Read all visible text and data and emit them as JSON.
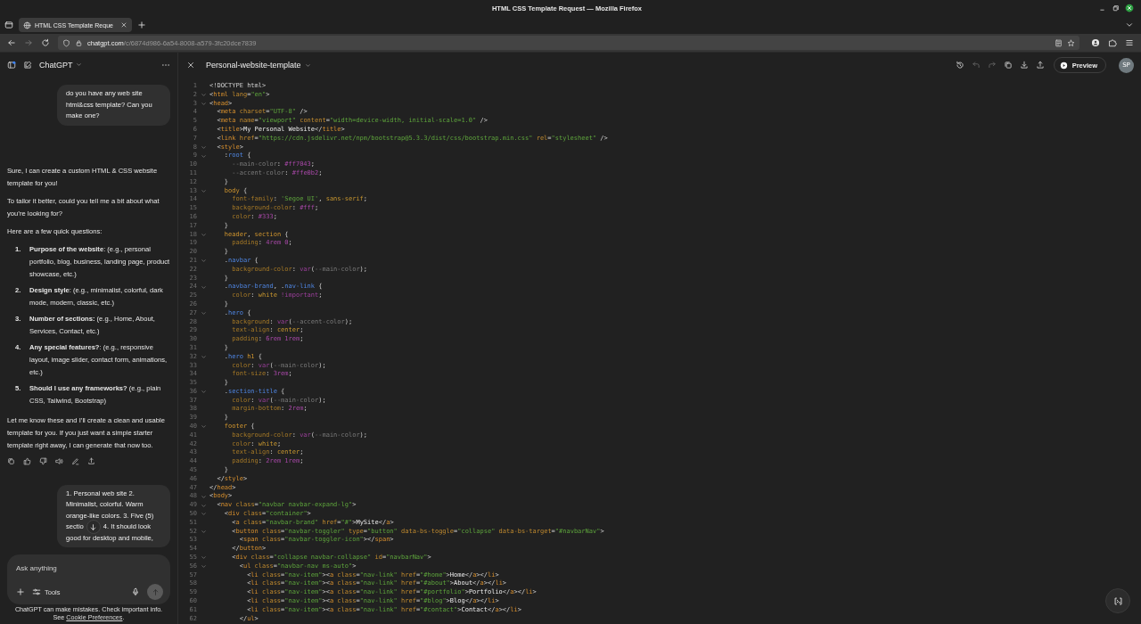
{
  "window": {
    "title": "HTML CSS Template Request — Mozilla Firefox"
  },
  "browser": {
    "tabs": [
      {
        "title": "HTML CSS Template Reque",
        "selected": true
      }
    ],
    "nav": [
      {
        "kind": "back",
        "disabled": false
      },
      {
        "kind": "forward",
        "disabled": true
      },
      {
        "kind": "reload",
        "disabled": false
      }
    ],
    "url": {
      "host": "chatgpt.com",
      "path": "/c/6874d986-6a54-8008-a579-3fc20dce7839"
    }
  },
  "chat": {
    "title": "ChatGPT",
    "messages": [
      {
        "kind": "user",
        "text": "do you have any web site html&css template? Can you make one?"
      },
      {
        "kind": "assistant",
        "blocks": [
          {
            "kind": "paragraph",
            "text": "Sure, I can create a custom HTML & CSS website template for you!"
          },
          {
            "kind": "paragraph",
            "text": "To tailor it better, could you tell me a bit about what you’re looking for?"
          },
          {
            "kind": "paragraph",
            "text": "Here are a few quick questions:"
          },
          {
            "kind": "list",
            "items": [
              {
                "number": "1.",
                "text": "**Purpose of the website**: (e.g., personal portfolio, blog, business, landing page, product showcase, etc.)"
              },
              {
                "number": "2.",
                "text": "**Design style**: (e.g., minimalist, colorful, dark mode, modern, classic, etc.)"
              },
              {
                "number": "3.",
                "text": "**Number of sections:** (e.g., Home, About, Services, Contact, etc.)"
              },
              {
                "number": "4.",
                "text": "**Any special features?**: (e.g., responsive layout, image slider, contact form, animations, etc.)"
              },
              {
                "number": "5.",
                "text": "**Should I use any frameworks?** (e.g., plain CSS, Tailwind, Bootstrap)"
              }
            ]
          },
          {
            "kind": "paragraph",
            "text": "Let me know these and I’ll create a clean and usable template for you. If you just want a simple starter template right away, I can generate that now too."
          }
        ],
        "actions": [
          {
            "kind": "copy"
          },
          {
            "kind": "thumbs-up"
          },
          {
            "kind": "thumbs-down"
          },
          {
            "kind": "read-aloud"
          },
          {
            "kind": "edit"
          },
          {
            "kind": "share"
          }
        ]
      },
      {
        "kind": "user",
        "lines": [
          [
            "1. Personal web site 2."
          ],
          [
            "Minimalist, colorful. Warm"
          ],
          [
            "orange-like colors. 3. Five (5)"
          ],
          [
            "sectio",
            "4. It should look"
          ],
          [
            "good for desktop and mobile,"
          ]
        ]
      }
    ],
    "composer": {
      "placeholder": "Ask anything",
      "tools": "Tools"
    },
    "footer": {
      "note": "ChatGPT can make mistakes. Check important info.",
      "before": "See",
      "link": "Cookie Preferences",
      "after": "."
    }
  },
  "canvas": {
    "title": "Personal-website-template",
    "tools": [
      {
        "kind": "history",
        "disabled": false
      },
      {
        "kind": "undo",
        "disabled": true
      },
      {
        "kind": "redo",
        "disabled": true
      },
      {
        "kind": "copy",
        "disabled": false
      },
      {
        "kind": "download",
        "disabled": false
      },
      {
        "kind": "share",
        "disabled": false
      }
    ],
    "preview": "Preview",
    "avatar": "SP",
    "code": [
      {
        "number": "1",
        "foldable": false,
        "tokens": [
          {
            "kind": "punct",
            "text": "<!DOCTYPE html>"
          }
        ]
      },
      {
        "number": "2",
        "foldable": true,
        "tokens": [
          {
            "kind": "punct",
            "text": "<"
          },
          {
            "kind": "tag",
            "text": "html"
          },
          {
            "kind": "attr",
            "text": " lang"
          },
          {
            "kind": "punct",
            "text": "="
          },
          {
            "kind": "string",
            "text": "\"en\""
          },
          {
            "kind": "punct",
            "text": ">"
          }
        ]
      },
      {
        "number": "3",
        "foldable": true,
        "tokens": [
          {
            "kind": "punct",
            "text": "<"
          },
          {
            "kind": "tag",
            "text": "head"
          },
          {
            "kind": "punct",
            "text": ">"
          }
        ]
      },
      {
        "number": "4",
        "foldable": false,
        "tokens": [
          {
            "kind": "punct",
            "text": "  <"
          },
          {
            "kind": "tag",
            "text": "meta"
          },
          {
            "kind": "attr",
            "text": " charset"
          },
          {
            "kind": "punct",
            "text": "="
          },
          {
            "kind": "string",
            "text": "\"UTF-8\""
          },
          {
            "kind": "punct",
            "text": " />"
          }
        ]
      },
      {
        "number": "5",
        "foldable": false,
        "tokens": [
          {
            "kind": "punct",
            "text": "  <"
          },
          {
            "kind": "tag",
            "text": "meta"
          },
          {
            "kind": "attr",
            "text": " name"
          },
          {
            "kind": "punct",
            "text": "="
          },
          {
            "kind": "string",
            "text": "\"viewport\""
          },
          {
            "kind": "attr",
            "text": " content"
          },
          {
            "kind": "punct",
            "text": "="
          },
          {
            "kind": "string",
            "text": "\"width=device-width, initial-scale=1.0\""
          },
          {
            "kind": "punct",
            "text": " />"
          }
        ]
      },
      {
        "number": "6",
        "foldable": false,
        "tokens": [
          {
            "kind": "punct",
            "text": "  <"
          },
          {
            "kind": "tag",
            "text": "title"
          },
          {
            "kind": "punct",
            "text": ">"
          },
          {
            "kind": "text",
            "text": "My Personal Website"
          },
          {
            "kind": "punct",
            "text": "</"
          },
          {
            "kind": "tag",
            "text": "title"
          },
          {
            "kind": "punct",
            "text": ">"
          }
        ]
      },
      {
        "number": "7",
        "foldable": false,
        "tokens": [
          {
            "kind": "punct",
            "text": "  <"
          },
          {
            "kind": "tag",
            "text": "link"
          },
          {
            "kind": "attr",
            "text": " href"
          },
          {
            "kind": "punct",
            "text": "="
          },
          {
            "kind": "string",
            "text": "\"https://cdn.jsdelivr.net/npm/bootstrap@5.3.3/dist/css/bootstrap.min.css\""
          },
          {
            "kind": "attr",
            "text": " rel"
          },
          {
            "kind": "punct",
            "text": "="
          },
          {
            "kind": "string",
            "text": "\"stylesheet\""
          },
          {
            "kind": "punct",
            "text": " />"
          }
        ]
      },
      {
        "number": "8",
        "foldable": true,
        "tokens": [
          {
            "kind": "punct",
            "text": "  <"
          },
          {
            "kind": "tag",
            "text": "style"
          },
          {
            "kind": "punct",
            "text": ">"
          }
        ]
      },
      {
        "number": "9",
        "foldable": true,
        "tokens": [
          {
            "kind": "punct",
            "text": "    :"
          },
          {
            "kind": "class",
            "text": "root"
          },
          {
            "kind": "punct",
            "text": " {"
          }
        ]
      },
      {
        "number": "10",
        "foldable": false,
        "tokens": [
          {
            "kind": "variable",
            "text": "      --main-color"
          },
          {
            "kind": "punct",
            "text": ": "
          },
          {
            "kind": "number",
            "text": "#ff7043"
          },
          {
            "kind": "punct",
            "text": ";"
          }
        ]
      },
      {
        "number": "11",
        "foldable": false,
        "tokens": [
          {
            "kind": "variable",
            "text": "      --accent-color"
          },
          {
            "kind": "punct",
            "text": ": "
          },
          {
            "kind": "number",
            "text": "#ffe0b2"
          },
          {
            "kind": "punct",
            "text": ";"
          }
        ]
      },
      {
        "number": "12",
        "foldable": false,
        "tokens": [
          {
            "kind": "punct",
            "text": "    }"
          }
        ]
      },
      {
        "number": "13",
        "foldable": true,
        "tokens": [
          {
            "kind": "selector",
            "text": "    body"
          },
          {
            "kind": "punct",
            "text": " {"
          }
        ]
      },
      {
        "number": "14",
        "foldable": false,
        "tokens": [
          {
            "kind": "property",
            "text": "      font-family"
          },
          {
            "kind": "punct",
            "text": ": "
          },
          {
            "kind": "string",
            "text": "'Segoe UI'"
          },
          {
            "kind": "punct",
            "text": ", "
          },
          {
            "kind": "value",
            "text": "sans-serif"
          },
          {
            "kind": "punct",
            "text": ";"
          }
        ]
      },
      {
        "number": "15",
        "foldable": false,
        "tokens": [
          {
            "kind": "property",
            "text": "      background-color"
          },
          {
            "kind": "punct",
            "text": ": "
          },
          {
            "kind": "number",
            "text": "#fff"
          },
          {
            "kind": "punct",
            "text": ";"
          }
        ]
      },
      {
        "number": "16",
        "foldable": false,
        "tokens": [
          {
            "kind": "property",
            "text": "      color"
          },
          {
            "kind": "punct",
            "text": ": "
          },
          {
            "kind": "number",
            "text": "#333"
          },
          {
            "kind": "punct",
            "text": ";"
          }
        ]
      },
      {
        "number": "17",
        "foldable": false,
        "tokens": [
          {
            "kind": "punct",
            "text": "    }"
          }
        ]
      },
      {
        "number": "18",
        "foldable": true,
        "tokens": [
          {
            "kind": "selector",
            "text": "    header"
          },
          {
            "kind": "punct",
            "text": ", "
          },
          {
            "kind": "selector",
            "text": "section"
          },
          {
            "kind": "punct",
            "text": " {"
          }
        ]
      },
      {
        "number": "19",
        "foldable": false,
        "tokens": [
          {
            "kind": "property",
            "text": "      padding"
          },
          {
            "kind": "punct",
            "text": ": "
          },
          {
            "kind": "number",
            "text": "4rem 0"
          },
          {
            "kind": "punct",
            "text": ";"
          }
        ]
      },
      {
        "number": "20",
        "foldable": false,
        "tokens": [
          {
            "kind": "punct",
            "text": "    }"
          }
        ]
      },
      {
        "number": "21",
        "foldable": true,
        "tokens": [
          {
            "kind": "punct",
            "text": "    ."
          },
          {
            "kind": "class",
            "text": "navbar"
          },
          {
            "kind": "punct",
            "text": " {"
          }
        ]
      },
      {
        "number": "22",
        "foldable": false,
        "tokens": [
          {
            "kind": "property",
            "text": "      background-color"
          },
          {
            "kind": "punct",
            "text": ": "
          },
          {
            "kind": "keyword",
            "text": "var"
          },
          {
            "kind": "punct",
            "text": "("
          },
          {
            "kind": "variable",
            "text": "--main-color"
          },
          {
            "kind": "punct",
            "text": ");"
          }
        ]
      },
      {
        "number": "23",
        "foldable": false,
        "tokens": [
          {
            "kind": "punct",
            "text": "    }"
          }
        ]
      },
      {
        "number": "24",
        "foldable": true,
        "tokens": [
          {
            "kind": "punct",
            "text": "    ."
          },
          {
            "kind": "class",
            "text": "navbar-brand"
          },
          {
            "kind": "punct",
            "text": ", ."
          },
          {
            "kind": "class",
            "text": "nav-link"
          },
          {
            "kind": "punct",
            "text": " {"
          }
        ]
      },
      {
        "number": "25",
        "foldable": false,
        "tokens": [
          {
            "kind": "property",
            "text": "      color"
          },
          {
            "kind": "punct",
            "text": ": "
          },
          {
            "kind": "value",
            "text": "white"
          },
          {
            "kind": "keyword",
            "text": " !important"
          },
          {
            "kind": "punct",
            "text": ";"
          }
        ]
      },
      {
        "number": "26",
        "foldable": false,
        "tokens": [
          {
            "kind": "punct",
            "text": "    }"
          }
        ]
      },
      {
        "number": "27",
        "foldable": true,
        "tokens": [
          {
            "kind": "punct",
            "text": "    ."
          },
          {
            "kind": "class",
            "text": "hero"
          },
          {
            "kind": "punct",
            "text": " {"
          }
        ]
      },
      {
        "number": "28",
        "foldable": false,
        "tokens": [
          {
            "kind": "property",
            "text": "      background"
          },
          {
            "kind": "punct",
            "text": ": "
          },
          {
            "kind": "keyword",
            "text": "var"
          },
          {
            "kind": "punct",
            "text": "("
          },
          {
            "kind": "variable",
            "text": "--accent-color"
          },
          {
            "kind": "punct",
            "text": ");"
          }
        ]
      },
      {
        "number": "29",
        "foldable": false,
        "tokens": [
          {
            "kind": "property",
            "text": "      text-align"
          },
          {
            "kind": "punct",
            "text": ": "
          },
          {
            "kind": "value",
            "text": "center"
          },
          {
            "kind": "punct",
            "text": ";"
          }
        ]
      },
      {
        "number": "30",
        "foldable": false,
        "tokens": [
          {
            "kind": "property",
            "text": "      padding"
          },
          {
            "kind": "punct",
            "text": ": "
          },
          {
            "kind": "number",
            "text": "6rem 1rem"
          },
          {
            "kind": "punct",
            "text": ";"
          }
        ]
      },
      {
        "number": "31",
        "foldable": false,
        "tokens": [
          {
            "kind": "punct",
            "text": "    }"
          }
        ]
      },
      {
        "number": "32",
        "foldable": true,
        "tokens": [
          {
            "kind": "punct",
            "text": "    ."
          },
          {
            "kind": "class",
            "text": "hero"
          },
          {
            "kind": "selector",
            "text": " h1"
          },
          {
            "kind": "punct",
            "text": " {"
          }
        ]
      },
      {
        "number": "33",
        "foldable": false,
        "tokens": [
          {
            "kind": "property",
            "text": "      color"
          },
          {
            "kind": "punct",
            "text": ": "
          },
          {
            "kind": "keyword",
            "text": "var"
          },
          {
            "kind": "punct",
            "text": "("
          },
          {
            "kind": "variable",
            "text": "--main-color"
          },
          {
            "kind": "punct",
            "text": ");"
          }
        ]
      },
      {
        "number": "34",
        "foldable": false,
        "tokens": [
          {
            "kind": "property",
            "text": "      font-size"
          },
          {
            "kind": "punct",
            "text": ": "
          },
          {
            "kind": "number",
            "text": "3rem"
          },
          {
            "kind": "punct",
            "text": ";"
          }
        ]
      },
      {
        "number": "35",
        "foldable": false,
        "tokens": [
          {
            "kind": "punct",
            "text": "    }"
          }
        ]
      },
      {
        "number": "36",
        "foldable": true,
        "tokens": [
          {
            "kind": "punct",
            "text": "    ."
          },
          {
            "kind": "class",
            "text": "section-title"
          },
          {
            "kind": "punct",
            "text": " {"
          }
        ]
      },
      {
        "number": "37",
        "foldable": false,
        "tokens": [
          {
            "kind": "property",
            "text": "      color"
          },
          {
            "kind": "punct",
            "text": ": "
          },
          {
            "kind": "keyword",
            "text": "var"
          },
          {
            "kind": "punct",
            "text": "("
          },
          {
            "kind": "variable",
            "text": "--main-color"
          },
          {
            "kind": "punct",
            "text": ");"
          }
        ]
      },
      {
        "number": "38",
        "foldable": false,
        "tokens": [
          {
            "kind": "property",
            "text": "      margin-bottom"
          },
          {
            "kind": "punct",
            "text": ": "
          },
          {
            "kind": "number",
            "text": "2rem"
          },
          {
            "kind": "punct",
            "text": ";"
          }
        ]
      },
      {
        "number": "39",
        "foldable": false,
        "tokens": [
          {
            "kind": "punct",
            "text": "    }"
          }
        ]
      },
      {
        "number": "40",
        "foldable": true,
        "tokens": [
          {
            "kind": "selector",
            "text": "    footer"
          },
          {
            "kind": "punct",
            "text": " {"
          }
        ]
      },
      {
        "number": "41",
        "foldable": false,
        "tokens": [
          {
            "kind": "property",
            "text": "      background-color"
          },
          {
            "kind": "punct",
            "text": ": "
          },
          {
            "kind": "keyword",
            "text": "var"
          },
          {
            "kind": "punct",
            "text": "("
          },
          {
            "kind": "variable",
            "text": "--main-color"
          },
          {
            "kind": "punct",
            "text": ");"
          }
        ]
      },
      {
        "number": "42",
        "foldable": false,
        "tokens": [
          {
            "kind": "property",
            "text": "      color"
          },
          {
            "kind": "punct",
            "text": ": "
          },
          {
            "kind": "value",
            "text": "white"
          },
          {
            "kind": "punct",
            "text": ";"
          }
        ]
      },
      {
        "number": "43",
        "foldable": false,
        "tokens": [
          {
            "kind": "property",
            "text": "      text-align"
          },
          {
            "kind": "punct",
            "text": ": "
          },
          {
            "kind": "value",
            "text": "center"
          },
          {
            "kind": "punct",
            "text": ";"
          }
        ]
      },
      {
        "number": "44",
        "foldable": false,
        "tokens": [
          {
            "kind": "property",
            "text": "      padding"
          },
          {
            "kind": "punct",
            "text": ": "
          },
          {
            "kind": "number",
            "text": "2rem 1rem"
          },
          {
            "kind": "punct",
            "text": ";"
          }
        ]
      },
      {
        "number": "45",
        "foldable": false,
        "tokens": [
          {
            "kind": "punct",
            "text": "    }"
          }
        ]
      },
      {
        "number": "46",
        "foldable": false,
        "tokens": [
          {
            "kind": "punct",
            "text": "  </"
          },
          {
            "kind": "tag",
            "text": "style"
          },
          {
            "kind": "punct",
            "text": ">"
          }
        ]
      },
      {
        "number": "47",
        "foldable": false,
        "tokens": [
          {
            "kind": "punct",
            "text": "</"
          },
          {
            "kind": "tag",
            "text": "head"
          },
          {
            "kind": "punct",
            "text": ">"
          }
        ]
      },
      {
        "number": "48",
        "foldable": true,
        "tokens": [
          {
            "kind": "punct",
            "text": "<"
          },
          {
            "kind": "tag",
            "text": "body"
          },
          {
            "kind": "punct",
            "text": ">"
          }
        ]
      },
      {
        "number": "49",
        "foldable": true,
        "tokens": [
          {
            "kind": "punct",
            "text": "  <"
          },
          {
            "kind": "tag",
            "text": "nav"
          },
          {
            "kind": "attr",
            "text": " class"
          },
          {
            "kind": "punct",
            "text": "="
          },
          {
            "kind": "string",
            "text": "\"navbar navbar-expand-lg\""
          },
          {
            "kind": "punct",
            "text": ">"
          }
        ]
      },
      {
        "number": "50",
        "foldable": true,
        "tokens": [
          {
            "kind": "punct",
            "text": "    <"
          },
          {
            "kind": "tag",
            "text": "div"
          },
          {
            "kind": "attr",
            "text": " class"
          },
          {
            "kind": "punct",
            "text": "="
          },
          {
            "kind": "string",
            "text": "\"container\""
          },
          {
            "kind": "punct",
            "text": ">"
          }
        ]
      },
      {
        "number": "51",
        "foldable": false,
        "tokens": [
          {
            "kind": "punct",
            "text": "      <"
          },
          {
            "kind": "tag",
            "text": "a"
          },
          {
            "kind": "attr",
            "text": " class"
          },
          {
            "kind": "punct",
            "text": "="
          },
          {
            "kind": "string",
            "text": "\"navbar-brand\""
          },
          {
            "kind": "attr",
            "text": " href"
          },
          {
            "kind": "punct",
            "text": "="
          },
          {
            "kind": "string",
            "text": "\"#\""
          },
          {
            "kind": "punct",
            "text": ">"
          },
          {
            "kind": "text",
            "text": "MySite"
          },
          {
            "kind": "punct",
            "text": "</"
          },
          {
            "kind": "tag",
            "text": "a"
          },
          {
            "kind": "punct",
            "text": ">"
          }
        ]
      },
      {
        "number": "52",
        "foldable": true,
        "tokens": [
          {
            "kind": "punct",
            "text": "      <"
          },
          {
            "kind": "tag",
            "text": "button"
          },
          {
            "kind": "attr",
            "text": " class"
          },
          {
            "kind": "punct",
            "text": "="
          },
          {
            "kind": "string",
            "text": "\"navbar-toggler\""
          },
          {
            "kind": "attr",
            "text": " type"
          },
          {
            "kind": "punct",
            "text": "="
          },
          {
            "kind": "string",
            "text": "\"button\""
          },
          {
            "kind": "attr",
            "text": " data-bs-toggle"
          },
          {
            "kind": "punct",
            "text": "="
          },
          {
            "kind": "string",
            "text": "\"collapse\""
          },
          {
            "kind": "attr",
            "text": " data-bs-target"
          },
          {
            "kind": "punct",
            "text": "="
          },
          {
            "kind": "string",
            "text": "\"#navbarNav\""
          },
          {
            "kind": "punct",
            "text": ">"
          }
        ]
      },
      {
        "number": "53",
        "foldable": false,
        "tokens": [
          {
            "kind": "punct",
            "text": "        <"
          },
          {
            "kind": "tag",
            "text": "span"
          },
          {
            "kind": "attr",
            "text": " class"
          },
          {
            "kind": "punct",
            "text": "="
          },
          {
            "kind": "string",
            "text": "\"navbar-toggler-icon\""
          },
          {
            "kind": "punct",
            "text": "></"
          },
          {
            "kind": "tag",
            "text": "span"
          },
          {
            "kind": "punct",
            "text": ">"
          }
        ]
      },
      {
        "number": "54",
        "foldable": false,
        "tokens": [
          {
            "kind": "punct",
            "text": "      </"
          },
          {
            "kind": "tag",
            "text": "button"
          },
          {
            "kind": "punct",
            "text": ">"
          }
        ]
      },
      {
        "number": "55",
        "foldable": true,
        "tokens": [
          {
            "kind": "punct",
            "text": "      <"
          },
          {
            "kind": "tag",
            "text": "div"
          },
          {
            "kind": "attr",
            "text": " class"
          },
          {
            "kind": "punct",
            "text": "="
          },
          {
            "kind": "string",
            "text": "\"collapse navbar-collapse\""
          },
          {
            "kind": "attr",
            "text": " id"
          },
          {
            "kind": "punct",
            "text": "="
          },
          {
            "kind": "string",
            "text": "\"navbarNav\""
          },
          {
            "kind": "punct",
            "text": ">"
          }
        ]
      },
      {
        "number": "56",
        "foldable": true,
        "tokens": [
          {
            "kind": "punct",
            "text": "        <"
          },
          {
            "kind": "tag",
            "text": "ul"
          },
          {
            "kind": "attr",
            "text": " class"
          },
          {
            "kind": "punct",
            "text": "="
          },
          {
            "kind": "string",
            "text": "\"navbar-nav ms-auto\""
          },
          {
            "kind": "punct",
            "text": ">"
          }
        ]
      },
      {
        "number": "57",
        "foldable": false,
        "tokens": [
          {
            "kind": "punct",
            "text": "          <"
          },
          {
            "kind": "tag",
            "text": "li"
          },
          {
            "kind": "attr",
            "text": " class"
          },
          {
            "kind": "punct",
            "text": "="
          },
          {
            "kind": "string",
            "text": "\"nav-item\""
          },
          {
            "kind": "punct",
            "text": "><"
          },
          {
            "kind": "tag",
            "text": "a"
          },
          {
            "kind": "attr",
            "text": " class"
          },
          {
            "kind": "punct",
            "text": "="
          },
          {
            "kind": "string",
            "text": "\"nav-link\""
          },
          {
            "kind": "attr",
            "text": " href"
          },
          {
            "kind": "punct",
            "text": "="
          },
          {
            "kind": "string",
            "text": "\"#home\""
          },
          {
            "kind": "punct",
            "text": ">"
          },
          {
            "kind": "text",
            "text": "Home"
          },
          {
            "kind": "punct",
            "text": "</"
          },
          {
            "kind": "tag",
            "text": "a"
          },
          {
            "kind": "punct",
            "text": "></"
          },
          {
            "kind": "tag",
            "text": "li"
          },
          {
            "kind": "punct",
            "text": ">"
          }
        ]
      },
      {
        "number": "58",
        "foldable": false,
        "tokens": [
          {
            "kind": "punct",
            "text": "          <"
          },
          {
            "kind": "tag",
            "text": "li"
          },
          {
            "kind": "attr",
            "text": " class"
          },
          {
            "kind": "punct",
            "text": "="
          },
          {
            "kind": "string",
            "text": "\"nav-item\""
          },
          {
            "kind": "punct",
            "text": "><"
          },
          {
            "kind": "tag",
            "text": "a"
          },
          {
            "kind": "attr",
            "text": " class"
          },
          {
            "kind": "punct",
            "text": "="
          },
          {
            "kind": "string",
            "text": "\"nav-link\""
          },
          {
            "kind": "attr",
            "text": " href"
          },
          {
            "kind": "punct",
            "text": "="
          },
          {
            "kind": "string",
            "text": "\"#about\""
          },
          {
            "kind": "punct",
            "text": ">"
          },
          {
            "kind": "text",
            "text": "About"
          },
          {
            "kind": "punct",
            "text": "</"
          },
          {
            "kind": "tag",
            "text": "a"
          },
          {
            "kind": "punct",
            "text": "></"
          },
          {
            "kind": "tag",
            "text": "li"
          },
          {
            "kind": "punct",
            "text": ">"
          }
        ]
      },
      {
        "number": "59",
        "foldable": false,
        "tokens": [
          {
            "kind": "punct",
            "text": "          <"
          },
          {
            "kind": "tag",
            "text": "li"
          },
          {
            "kind": "attr",
            "text": " class"
          },
          {
            "kind": "punct",
            "text": "="
          },
          {
            "kind": "string",
            "text": "\"nav-item\""
          },
          {
            "kind": "punct",
            "text": "><"
          },
          {
            "kind": "tag",
            "text": "a"
          },
          {
            "kind": "attr",
            "text": " class"
          },
          {
            "kind": "punct",
            "text": "="
          },
          {
            "kind": "string",
            "text": "\"nav-link\""
          },
          {
            "kind": "attr",
            "text": " href"
          },
          {
            "kind": "punct",
            "text": "="
          },
          {
            "kind": "string",
            "text": "\"#portfolio\""
          },
          {
            "kind": "punct",
            "text": ">"
          },
          {
            "kind": "text",
            "text": "Portfolio"
          },
          {
            "kind": "punct",
            "text": "</"
          },
          {
            "kind": "tag",
            "text": "a"
          },
          {
            "kind": "punct",
            "text": "></"
          },
          {
            "kind": "tag",
            "text": "li"
          },
          {
            "kind": "punct",
            "text": ">"
          }
        ]
      },
      {
        "number": "60",
        "foldable": false,
        "tokens": [
          {
            "kind": "punct",
            "text": "          <"
          },
          {
            "kind": "tag",
            "text": "li"
          },
          {
            "kind": "attr",
            "text": " class"
          },
          {
            "kind": "punct",
            "text": "="
          },
          {
            "kind": "string",
            "text": "\"nav-item\""
          },
          {
            "kind": "punct",
            "text": "><"
          },
          {
            "kind": "tag",
            "text": "a"
          },
          {
            "kind": "attr",
            "text": " class"
          },
          {
            "kind": "punct",
            "text": "="
          },
          {
            "kind": "string",
            "text": "\"nav-link\""
          },
          {
            "kind": "attr",
            "text": " href"
          },
          {
            "kind": "punct",
            "text": "="
          },
          {
            "kind": "string",
            "text": "\"#blog\""
          },
          {
            "kind": "punct",
            "text": ">"
          },
          {
            "kind": "text",
            "text": "Blog"
          },
          {
            "kind": "punct",
            "text": "</"
          },
          {
            "kind": "tag",
            "text": "a"
          },
          {
            "kind": "punct",
            "text": "></"
          },
          {
            "kind": "tag",
            "text": "li"
          },
          {
            "kind": "punct",
            "text": ">"
          }
        ]
      },
      {
        "number": "61",
        "foldable": false,
        "tokens": [
          {
            "kind": "punct",
            "text": "          <"
          },
          {
            "kind": "tag",
            "text": "li"
          },
          {
            "kind": "attr",
            "text": " class"
          },
          {
            "kind": "punct",
            "text": "="
          },
          {
            "kind": "string",
            "text": "\"nav-item\""
          },
          {
            "kind": "punct",
            "text": "><"
          },
          {
            "kind": "tag",
            "text": "a"
          },
          {
            "kind": "attr",
            "text": " class"
          },
          {
            "kind": "punct",
            "text": "="
          },
          {
            "kind": "string",
            "text": "\"nav-link\""
          },
          {
            "kind": "attr",
            "text": " href"
          },
          {
            "kind": "punct",
            "text": "="
          },
          {
            "kind": "string",
            "text": "\"#contact\""
          },
          {
            "kind": "punct",
            "text": ">"
          },
          {
            "kind": "text",
            "text": "Contact"
          },
          {
            "kind": "punct",
            "text": "</"
          },
          {
            "kind": "tag",
            "text": "a"
          },
          {
            "kind": "punct",
            "text": "></"
          },
          {
            "kind": "tag",
            "text": "li"
          },
          {
            "kind": "punct",
            "text": ">"
          }
        ]
      },
      {
        "number": "62",
        "foldable": false,
        "tokens": [
          {
            "kind": "punct",
            "text": "        </"
          },
          {
            "kind": "tag",
            "text": "ul"
          },
          {
            "kind": "punct",
            "text": ">"
          }
        ]
      }
    ]
  }
}
